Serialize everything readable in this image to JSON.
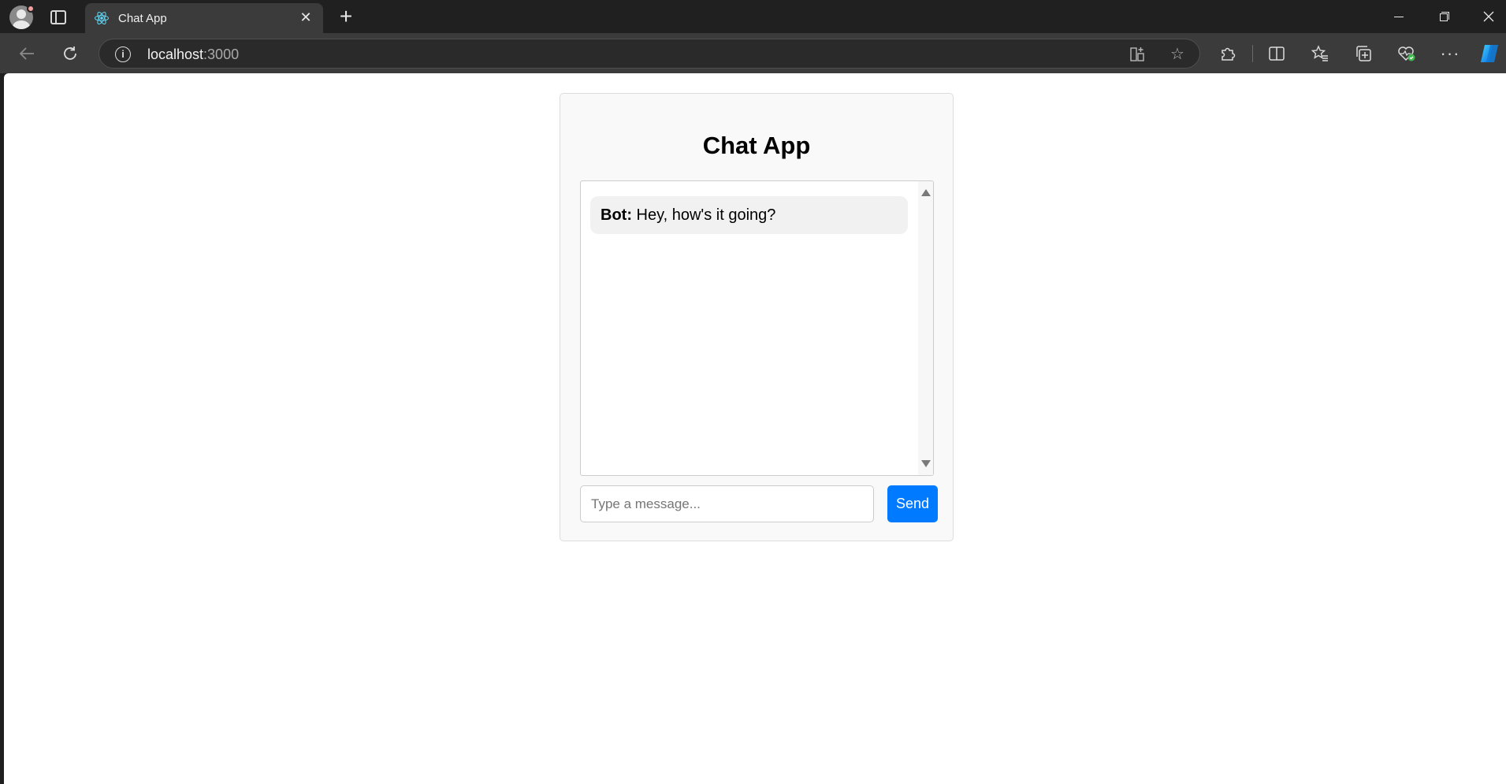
{
  "browser": {
    "tab_title": "Chat App",
    "tab_close": "✕",
    "new_tab": "+",
    "url_host": "localhost",
    "url_port": ":3000",
    "more": "···"
  },
  "app": {
    "title": "Chat App",
    "messages": [
      {
        "sender": "Bot:",
        "text": " Hey, how's it going?"
      }
    ],
    "input_placeholder": "Type a message...",
    "input_value": "",
    "send_label": "Send"
  },
  "colors": {
    "accent": "#007bff",
    "bubble": "#f1f1f1",
    "card": "#f9f9f9"
  },
  "icons": {
    "profile": "profile-avatar-icon",
    "tab_favicon": "react-logo-icon",
    "back": "back-arrow-icon",
    "refresh": "refresh-icon",
    "info": "site-info-icon",
    "apps": "app-available-icon",
    "favorite": "star-icon",
    "extensions": "puzzle-piece-icon",
    "split": "split-screen-icon",
    "favorites": "favorites-icon",
    "collections": "collections-icon",
    "health": "browser-essentials-icon",
    "copilot": "copilot-icon"
  }
}
